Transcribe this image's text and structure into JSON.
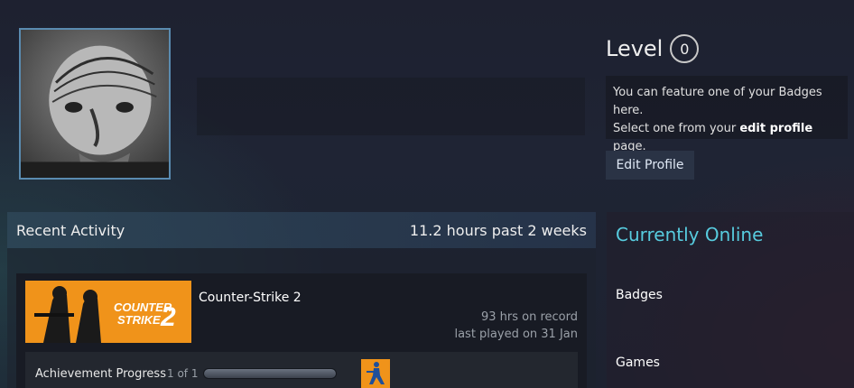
{
  "profile": {
    "avatar_icon": "user-avatar-image"
  },
  "level": {
    "label": "Level",
    "value": "0"
  },
  "badge_note": {
    "line1": "You can feature one of your Badges here.",
    "line2_prefix": "Select one from your ",
    "line2_link": "edit profile",
    "line2_suffix": " page."
  },
  "edit_profile_label": "Edit Profile",
  "recent_activity": {
    "title": "Recent Activity",
    "hours": "11.2 hours past 2 weeks",
    "game": {
      "name": "Counter-Strike 2",
      "capsule_text": "COUNTER STRIKE 2",
      "hours_on_record": "93 hrs on record",
      "last_played": "last played on 31 Jan",
      "achievement_label": "Achievement Progress",
      "achievement_count": "1 of 1",
      "achievement_progress": 1.0
    }
  },
  "sidebar": {
    "online_status": "Currently Online",
    "links": [
      "Badges",
      "Games"
    ]
  },
  "colors": {
    "online": "#57cbde",
    "button_bg": "#2a3345",
    "capsule_orange": "#f0931a"
  }
}
